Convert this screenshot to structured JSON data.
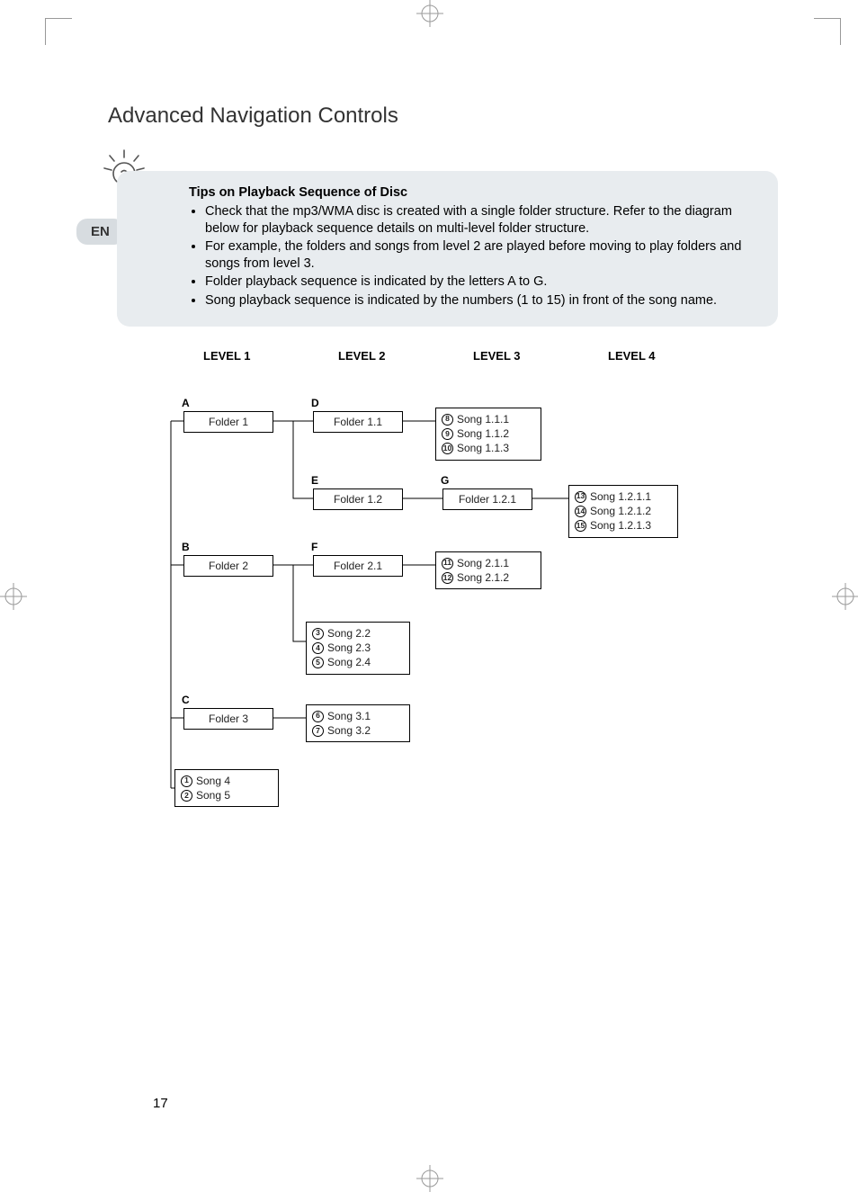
{
  "page_number": "17",
  "lang_tab": "EN",
  "title": "Advanced Navigation Controls",
  "tips": {
    "heading": "Tips on Playback Sequence of Disc",
    "items": [
      "Check that the mp3/WMA disc is created with a single folder structure. Refer to the diagram below for playback sequence details on multi-level folder structure.",
      "For example, the folders and songs from level 2 are played before moving to play folders and songs from level 3.",
      "Folder playback sequence is indicated by the letters A to G.",
      "Song playback sequence is indicated by the numbers (1 to 15) in front of the song name."
    ]
  },
  "levels": {
    "l1": "LEVEL 1",
    "l2": "LEVEL 2",
    "l3": "LEVEL 3",
    "l4": "LEVEL 4"
  },
  "letters": {
    "a": "A",
    "b": "B",
    "c": "C",
    "d": "D",
    "e": "E",
    "f": "F",
    "g": "G"
  },
  "nodes": {
    "folder1": "Folder 1",
    "folder2": "Folder 2",
    "folder3": "Folder 3",
    "folder11": "Folder 1.1",
    "folder12": "Folder 1.2",
    "folder21": "Folder 2.1",
    "folder121": "Folder 1.2.1"
  },
  "songs": {
    "s1": "Song 4",
    "n1": "1",
    "s2": "Song 5",
    "n2": "2",
    "s3": "Song 2.2",
    "n3": "3",
    "s4": "Song 2.3",
    "n4": "4",
    "s5": "Song 2.4",
    "n5": "5",
    "s6": "Song 3.1",
    "n6": "6",
    "s7": "Song 3.2",
    "n7": "7",
    "s8": "Song 1.1.1",
    "n8": "8",
    "s9": "Song 1.1.2",
    "n9": "9",
    "s10": "Song 1.1.3",
    "n10": "10",
    "s11": "Song 2.1.1",
    "n11": "11",
    "s12": "Song 2.1.2",
    "n12": "12",
    "s13": "Song 1.2.1.1",
    "n13": "13",
    "s14": "Song 1.2.1.2",
    "n14": "14",
    "s15": "Song 1.2.1.3",
    "n15": "15"
  }
}
